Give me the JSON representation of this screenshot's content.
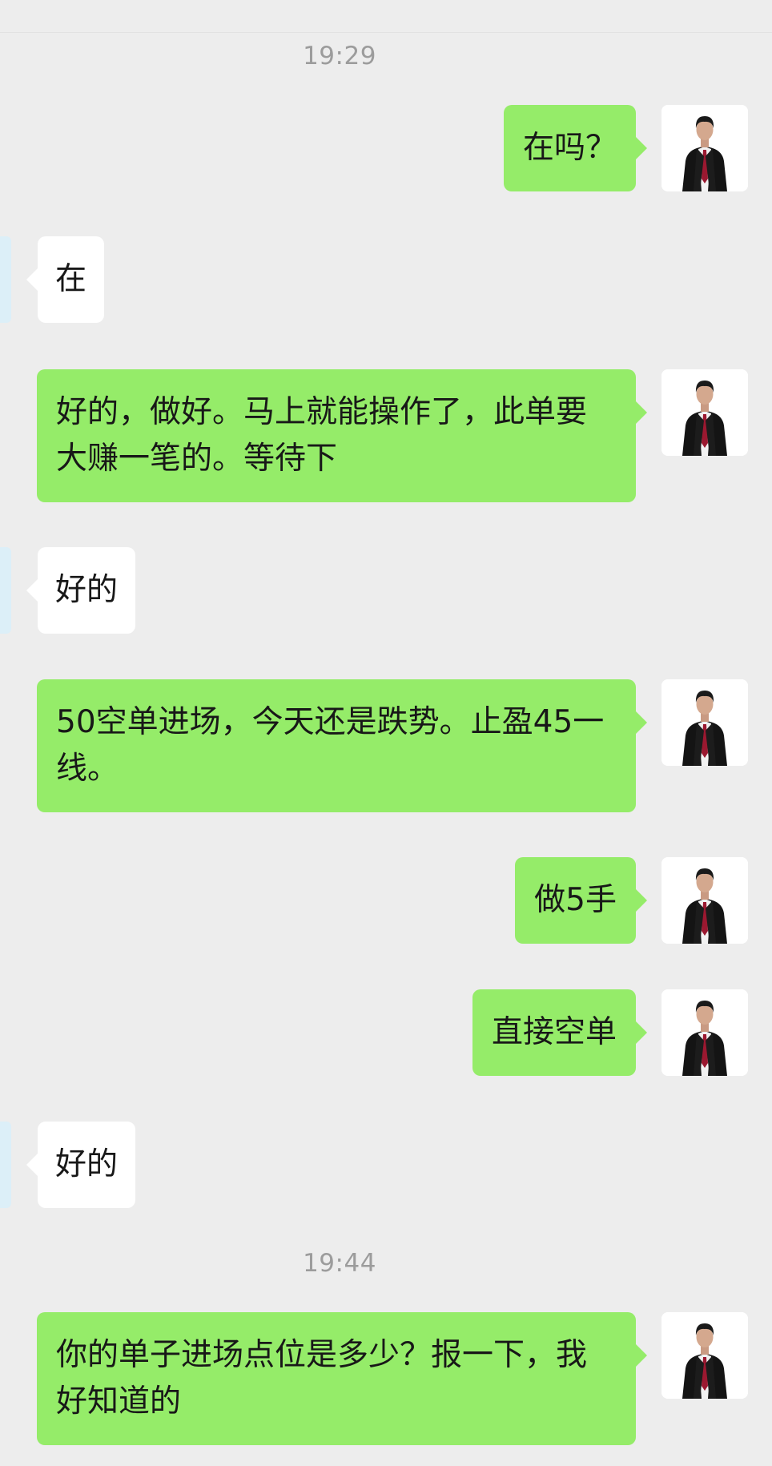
{
  "timestamps": [
    "19:29",
    "19:44"
  ],
  "messages": [
    {
      "side": "outgoing",
      "text": "在吗？"
    },
    {
      "side": "incoming",
      "text": "在"
    },
    {
      "side": "outgoing",
      "text": "好的，做好。马上就能操作了，此单要大赚一笔的。等待下"
    },
    {
      "side": "incoming",
      "text": "好的"
    },
    {
      "side": "outgoing",
      "text": "50空单进场，今天还是跌势。止盈45一线。"
    },
    {
      "side": "outgoing",
      "text": "做5手"
    },
    {
      "side": "outgoing",
      "text": "直接空单"
    },
    {
      "side": "incoming",
      "text": "好的"
    },
    {
      "side": "outgoing",
      "text": "你的单子进场点位是多少？报一下，我好知道的"
    }
  ],
  "colors": {
    "background": "#EDEDED",
    "outgoing_bubble": "#95EC69",
    "incoming_bubble": "#FFFFFF",
    "timestamp_text": "#9C9C9C"
  },
  "icons": {
    "avatar": "person-in-suit-avatar-icon"
  }
}
